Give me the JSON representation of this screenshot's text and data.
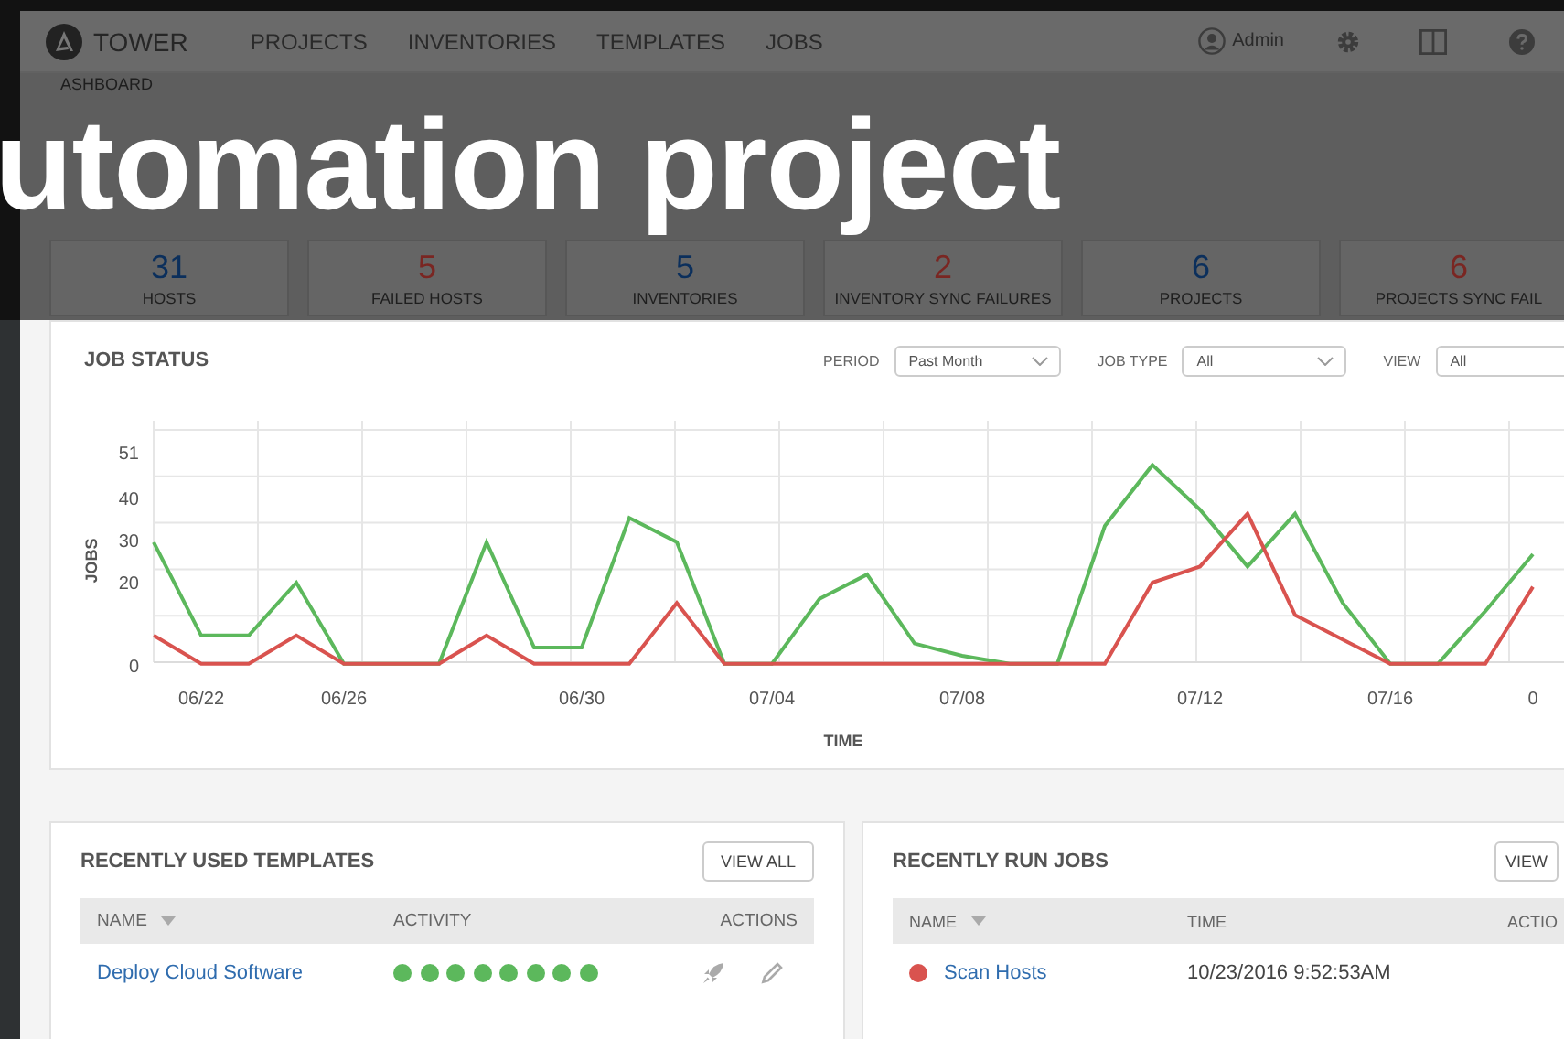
{
  "caption": "utomation project",
  "header": {
    "logo_text": "TOWER",
    "nav": [
      {
        "label": "PROJECTS"
      },
      {
        "label": "INVENTORIES"
      },
      {
        "label": "TEMPLATES"
      },
      {
        "label": "JOBS"
      }
    ],
    "user": "Admin"
  },
  "breadcrumb": "ASHBOARD",
  "counts": [
    {
      "value": "31",
      "label": "HOSTS",
      "color": "#0b2f5c"
    },
    {
      "value": "5",
      "label": "FAILED HOSTS",
      "color": "#7a2622"
    },
    {
      "value": "5",
      "label": "INVENTORIES",
      "color": "#0b2f5c"
    },
    {
      "value": "2",
      "label": "INVENTORY SYNC FAILURES",
      "color": "#7a2622"
    },
    {
      "value": "6",
      "label": "PROJECTS",
      "color": "#0b2f5c"
    },
    {
      "value": "6",
      "label": "PROJECTS SYNC FAIL",
      "color": "#7a2622"
    }
  ],
  "job_status": {
    "title": "JOB STATUS",
    "filters": [
      {
        "label": "PERIOD",
        "value": "Past Month"
      },
      {
        "label": "JOB TYPE",
        "value": "All"
      },
      {
        "label": "VIEW",
        "value": "All"
      }
    ],
    "chart_data": {
      "type": "line",
      "grid": true,
      "xlabel": "TIME",
      "ylabel": "JOBS",
      "ylim": [
        0,
        51
      ],
      "yticks": [
        0,
        20,
        30,
        40,
        51
      ],
      "categories": [
        null,
        "06/22",
        null,
        null,
        "06/26",
        null,
        null,
        null,
        null,
        "06/30",
        null,
        null,
        null,
        "07/04",
        null,
        null,
        null,
        "07/08",
        null,
        null,
        null,
        null,
        "07/12",
        null,
        null,
        null,
        "07/16",
        null,
        null,
        "0"
      ],
      "series": [
        {
          "color": "#5cb85c",
          "values": [
            30,
            7,
            7,
            20,
            0,
            0,
            0,
            30,
            4,
            4,
            36,
            30,
            0,
            0,
            16,
            22,
            5,
            2,
            0,
            0,
            34,
            49,
            38,
            24,
            37,
            15,
            0,
            0,
            13,
            27
          ]
        },
        {
          "color": "#d9534f",
          "values": [
            7,
            0,
            0,
            7,
            0,
            0,
            0,
            7,
            0,
            0,
            0,
            15,
            0,
            0,
            0,
            0,
            0,
            0,
            0,
            0,
            0,
            20,
            24,
            37,
            12,
            6,
            0,
            0,
            0,
            19
          ]
        }
      ]
    }
  },
  "templates": {
    "title": "RECENTLY USED TEMPLATES",
    "button": "VIEW ALL",
    "columns": [
      "NAME",
      "ACTIVITY",
      "ACTIONS"
    ],
    "rows": [
      {
        "name": "Deploy Cloud Software",
        "activity": [
          {
            "color": "#5cb85c"
          },
          {
            "color": "#5cb85c"
          },
          {
            "color": "#5cb85c"
          },
          {
            "color": "#5cb85c"
          },
          {
            "color": "#5cb85c"
          },
          {
            "color": "#5cb85c"
          },
          {
            "color": "#5cb85c"
          },
          {
            "color": "#5cb85c"
          }
        ]
      }
    ]
  },
  "jobs": {
    "title": "RECENTLY RUN JOBS",
    "button": "VIEW",
    "columns": [
      "NAME",
      "TIME",
      "ACTIO"
    ],
    "rows": [
      {
        "color": "#d9534f",
        "name": "Scan Hosts",
        "time": "10/23/2016 9:52:53AM"
      }
    ]
  }
}
